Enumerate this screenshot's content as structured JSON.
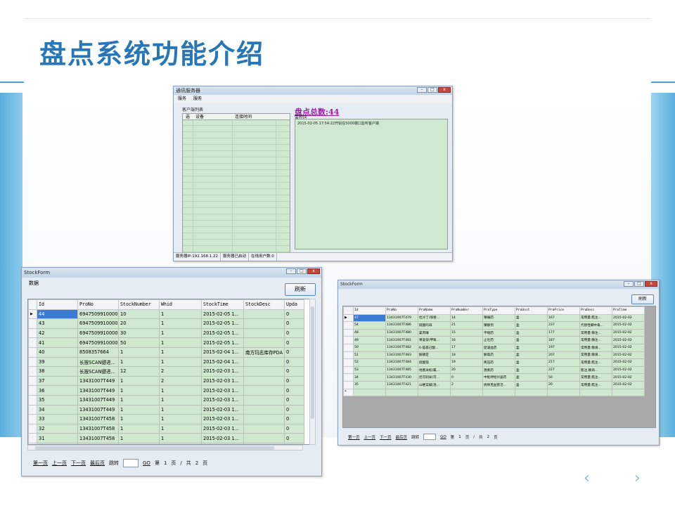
{
  "slide": {
    "title": "盘点系统功能介绍",
    "prev": "‹",
    "next": "›"
  },
  "server_window": {
    "title": "通讯服务器",
    "menu": [
      "服务",
      "服务"
    ],
    "client_group": "客户端列表",
    "client_columns": [
      "选",
      "设备",
      "连接时间"
    ],
    "total_label": "盘点总数:44",
    "monitor_label": "监控区",
    "monitor_log": "2015-02-05 17:54:22开始在5000端口监听客户端",
    "status": [
      "服务器IP:192.168.1.22",
      "服务器已启动",
      "在线用户数:0"
    ]
  },
  "stock_form_left": {
    "title": "StockForm",
    "data_label": "数据",
    "refresh": "刷新",
    "columns": [
      "Id",
      "ProNo",
      "StockNumber",
      "Whid",
      "StockTime",
      "StockDesc",
      "Upda"
    ],
    "rows": [
      [
        "44",
        "6947509910000",
        "10",
        "1",
        "2015-02-05 1...",
        "",
        "0"
      ],
      [
        "43",
        "6947509910000",
        "20",
        "1",
        "2015-02-05 1...",
        "",
        "0"
      ],
      [
        "42",
        "6947509910000",
        "30",
        "1",
        "2015-02-05 1...",
        "",
        "0"
      ],
      [
        "41",
        "6947509910000",
        "50",
        "1",
        "2015-02-05 1...",
        "",
        "0"
      ],
      [
        "40",
        "8508357664",
        "1",
        "1",
        "2015-02-04 1...",
        "南方玛志库存PDA",
        "0"
      ],
      [
        "39",
        "长按SCAN键进...",
        "1",
        "1",
        "2015-02-04 1...",
        "",
        "0"
      ],
      [
        "38",
        "长按SCAN键进...",
        "12",
        "2",
        "2015-02-03 1...",
        "",
        "0"
      ],
      [
        "37",
        "13431007T449",
        "1",
        "2",
        "2015-02-03 1...",
        "",
        "0"
      ],
      [
        "36",
        "13431007T449",
        "1",
        "1",
        "2015-02-03 1...",
        "",
        "0"
      ],
      [
        "35",
        "13431007T449",
        "1",
        "1",
        "2015-02-03 1...",
        "",
        "0"
      ],
      [
        "34",
        "13431007T449",
        "1",
        "1",
        "2015-02-03 1...",
        "",
        "0"
      ],
      [
        "33",
        "13431007T458",
        "1",
        "1",
        "2015-02-03 1...",
        "",
        "0"
      ],
      [
        "32",
        "13431007T458",
        "1",
        "1",
        "2015-02-03 1...",
        "",
        "0"
      ],
      [
        "31",
        "13431007T458",
        "1",
        "1",
        "2015-02-03 1...",
        "",
        "0"
      ],
      [
        "30",
        "13431007T458",
        "1",
        "1",
        "2015-02-03 1...",
        "",
        "0"
      ]
    ],
    "pager": {
      "first": "第一页",
      "prev": "上一页",
      "next": "下一页",
      "last": "最后页",
      "jump": "跳转",
      "go": "GO",
      "page_prefix": "第",
      "page": "1",
      "page_unit": "页",
      "sep": "/",
      "total_prefix": "共",
      "total": "2",
      "total_unit": "页"
    }
  },
  "stock_form_right": {
    "title": "StockForm",
    "refresh": "刷新",
    "columns": [
      "Id",
      "ProNo",
      "ProName",
      "ProNumber",
      "ProType",
      "ProUnit",
      "ProPrice",
      "ProDesc",
      "ProTime"
    ],
    "rows": [
      [
        "47",
        "13431007T479",
        "杜冷丁(哌替...",
        "14",
        "镇痛药",
        "盒",
        "167",
        "常用量:肌注...",
        "2015-02-02"
      ],
      [
        "54",
        "13431007T486",
        "硫酸吗啡",
        "21",
        "镇静剂",
        "盒",
        "237",
        "代替性脚中毒...",
        "2015-02-02"
      ],
      [
        "48",
        "13431007T480",
        "氯丙嗪",
        "15",
        "平喘药",
        "盒",
        "177",
        "常用量:静注...",
        "2015-02-02"
      ],
      [
        "49",
        "13431007T481",
        "胃复安(甲氧...",
        "16",
        "止吐药",
        "盒",
        "187",
        "常用量:静注...",
        "2015-02-02"
      ],
      [
        "50",
        "13431007T482",
        "6-氨基己酸...",
        "17",
        "促凝血药",
        "盒",
        "197",
        "常用量:静滴...",
        "2015-02-02"
      ],
      [
        "51",
        "13431007T483",
        "解磷定",
        "18",
        "解毒药",
        "盒",
        "207",
        "常用量:静滴...",
        "2015-02-02"
      ],
      [
        "52",
        "13431007T484",
        "硫酸镁",
        "19",
        "降压药",
        "盒",
        "217",
        "常用量:肌注...",
        "2015-02-02"
      ],
      [
        "53",
        "13431007T485",
        "地塞米松(氟...",
        "20",
        "激素药",
        "盒",
        "227",
        "肌注,静滴...",
        "2015-02-02"
      ],
      [
        "34",
        "13431007T430",
        "尼可刹米(可...",
        "0",
        "中枢神经兴奋药",
        "盒",
        "50",
        "常用量:肌注...",
        "2015-02-02"
      ],
      [
        "35",
        "13431007T421",
        "山梗菜碱(洛...",
        "2",
        "抗休克血管活...",
        "盒",
        "20",
        "常用量:肌注...",
        "2015-02-02"
      ]
    ],
    "pager": {
      "first": "第一页",
      "prev": "上一页",
      "next": "下一页",
      "last": "最后页",
      "jump": "跳转",
      "go": "GO",
      "page_prefix": "第",
      "page": "1",
      "page_unit": "页",
      "sep": "/",
      "total_prefix": "共",
      "total": "2",
      "total_unit": "页"
    }
  }
}
